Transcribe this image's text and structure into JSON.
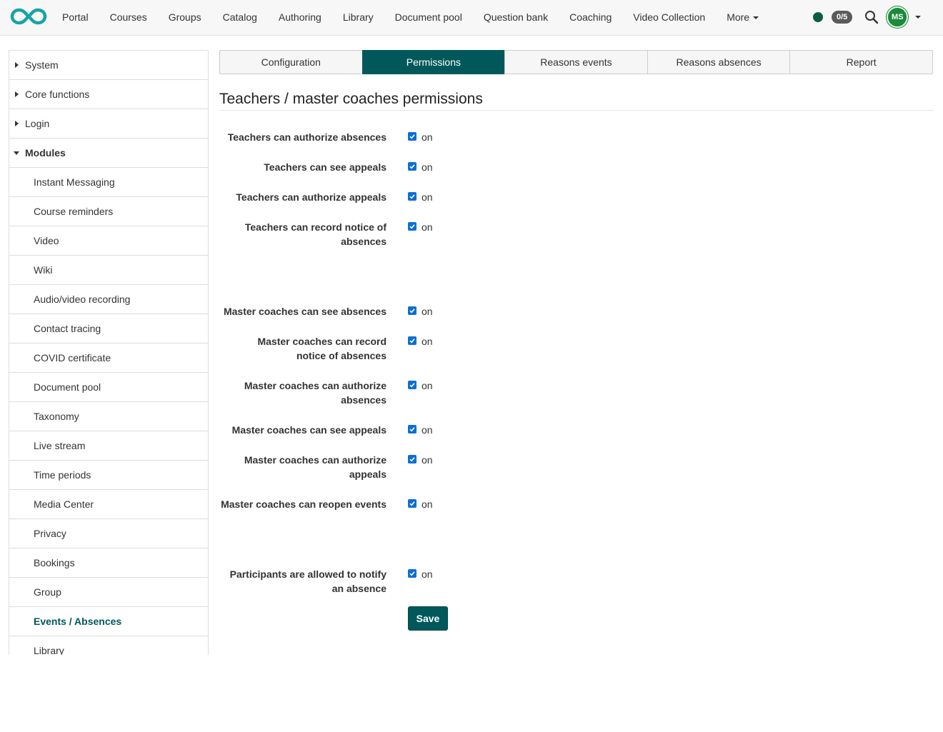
{
  "nav": {
    "items": [
      "Portal",
      "Courses",
      "Groups",
      "Catalog",
      "Authoring",
      "Library",
      "Document pool",
      "Question bank",
      "Coaching",
      "Video Collection"
    ],
    "more_label": "More",
    "badge_count": "0/5",
    "avatar_initials": "MS",
    "brand_color": "#00585b",
    "status_color": "#0b5d3f"
  },
  "sidebar": {
    "top_items": [
      {
        "label": "System",
        "state": "collapsed"
      },
      {
        "label": "Core functions",
        "state": "collapsed"
      },
      {
        "label": "Login",
        "state": "collapsed"
      },
      {
        "label": "Modules",
        "state": "expanded"
      }
    ],
    "module_items": [
      "Instant Messaging",
      "Course reminders",
      "Video",
      "Wiki",
      "Audio/video recording",
      "Contact tracing",
      "COVID certificate",
      "Document pool",
      "Taxonomy",
      "Live stream",
      "Time periods",
      "Media Center",
      "Privacy",
      "Bookings",
      "Group",
      "Events / Absences",
      "Library"
    ],
    "active_item": "Events / Absences"
  },
  "tabs": [
    {
      "label": "Configuration",
      "active": false
    },
    {
      "label": "Permissions",
      "active": true
    },
    {
      "label": "Reasons events",
      "active": false
    },
    {
      "label": "Reasons absences",
      "active": false
    },
    {
      "label": "Report",
      "active": false
    }
  ],
  "page": {
    "title": "Teachers / master coaches permissions",
    "save_label": "Save",
    "checkbox_text": "on"
  },
  "permissions": [
    {
      "label": "Teachers can authorize absences",
      "checked": true
    },
    {
      "label": "Teachers can see appeals",
      "checked": true
    },
    {
      "label": "Teachers can authorize appeals",
      "checked": true
    },
    {
      "label": "Teachers can record notice of absences",
      "checked": true
    },
    {
      "label": "Master coaches can see absences",
      "checked": true
    },
    {
      "label": "Master coaches can record notice of absences",
      "checked": true
    },
    {
      "label": "Master coaches can authorize absences",
      "checked": true
    },
    {
      "label": "Master coaches can see appeals",
      "checked": true
    },
    {
      "label": "Master coaches can authorize appeals",
      "checked": true
    },
    {
      "label": "Master coaches can reopen events",
      "checked": true
    },
    {
      "label": "Participants are allowed to notify an absence",
      "checked": true
    }
  ]
}
